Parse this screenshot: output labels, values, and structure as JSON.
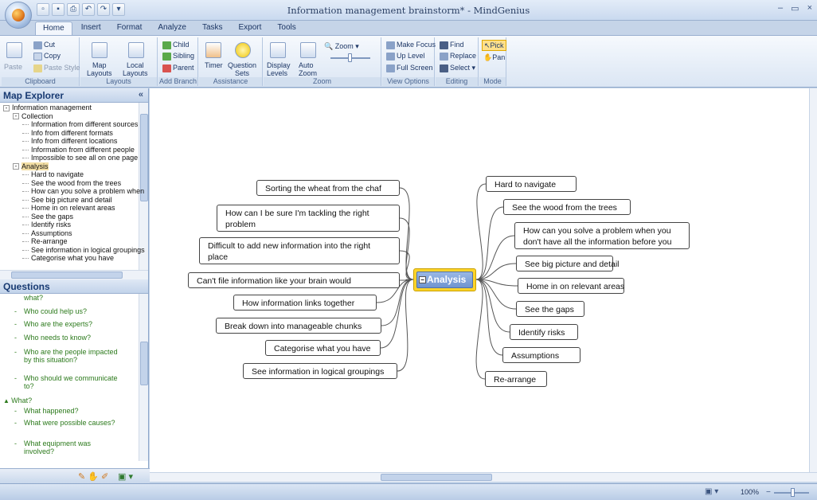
{
  "window": {
    "title": "Information management brainstorm* - MindGenius"
  },
  "tabs": [
    "Home",
    "Insert",
    "Format",
    "Analyze",
    "Tasks",
    "Export",
    "Tools"
  ],
  "ribbon": {
    "clipboard": {
      "label": "Clipboard",
      "paste": "Paste",
      "cut": "Cut",
      "copy": "Copy",
      "paste_style": "Paste Style"
    },
    "layouts": {
      "label": "Layouts",
      "map": "Map\nLayouts",
      "local": "Local\nLayouts"
    },
    "add_branch": {
      "label": "Add Branch",
      "child": "Child",
      "sibling": "Sibling",
      "parent": "Parent"
    },
    "assistance": {
      "label": "Assistance",
      "timer": "Timer",
      "question_sets": "Question\nSets"
    },
    "zoom": {
      "label": "Zoom",
      "display_levels": "Display\nLevels",
      "auto_zoom": "Auto\nZoom",
      "zoom": "Zoom"
    },
    "view_options": {
      "label": "View Options",
      "make_focus": "Make Focus",
      "up_level": "Up Level",
      "full_screen": "Full Screen"
    },
    "editing": {
      "label": "Editing",
      "find": "Find",
      "replace": "Replace",
      "select": "Select"
    },
    "mode": {
      "label": "Mode",
      "pick": "Pick",
      "pan": "Pan"
    }
  },
  "map_explorer": {
    "title": "Map Explorer",
    "items": [
      {
        "text": "Information management",
        "indent": 0,
        "expander": "-"
      },
      {
        "text": "Collection",
        "indent": 1,
        "expander": "-"
      },
      {
        "text": "Information from different sources",
        "indent": 2
      },
      {
        "text": "Info from different formats",
        "indent": 2
      },
      {
        "text": "Info from different locations",
        "indent": 2
      },
      {
        "text": "Information from different people",
        "indent": 2
      },
      {
        "text": "Impossible to see all on one page",
        "indent": 2
      },
      {
        "text": "Analysis",
        "indent": 1,
        "expander": "-",
        "selected": true
      },
      {
        "text": "Hard to navigate",
        "indent": 2
      },
      {
        "text": "See the wood from the trees",
        "indent": 2
      },
      {
        "text": "How can you solve a problem when",
        "indent": 2
      },
      {
        "text": "See big picture and detail",
        "indent": 2
      },
      {
        "text": "Home in on relevant areas",
        "indent": 2
      },
      {
        "text": "See the gaps",
        "indent": 2
      },
      {
        "text": "Identify risks",
        "indent": 2
      },
      {
        "text": "Assumptions",
        "indent": 2
      },
      {
        "text": "Re-arrange",
        "indent": 2
      },
      {
        "text": "See information in logical groupings",
        "indent": 2
      },
      {
        "text": "Categorise what you have",
        "indent": 2
      }
    ]
  },
  "questions": {
    "title": "Questions",
    "items": [
      {
        "text": "what?",
        "kind": "cut"
      },
      {
        "text": "Who could help us?"
      },
      {
        "text": "Who are the experts?"
      },
      {
        "text": "Who needs to know?"
      },
      {
        "text": "Who are the people impacted by this situation?"
      },
      {
        "text": "Who should we communicate to?"
      },
      {
        "text": "What?",
        "kind": "header"
      },
      {
        "text": "What happened?"
      },
      {
        "text": "What were possible causes?"
      },
      {
        "text": "What equipment was involved?"
      }
    ]
  },
  "map": {
    "central": "Analysis",
    "left": [
      "Sorting the wheat from the chaf",
      "How can I be sure I'm tackling the right problem",
      "Difficult to add new information into the right place",
      "Can't file information like your brain would",
      "How information links together",
      "Break down into manageable chunks",
      "Categorise what you have",
      "See information in logical groupings"
    ],
    "right": [
      "Hard to navigate",
      "See the wood from the trees",
      "How can you solve a problem when you don't have all the information before you",
      "See big picture and detail",
      "Home in on relevant areas",
      "See the gaps",
      "Identify risks",
      "Assumptions",
      "Re-arrange"
    ]
  },
  "status": {
    "zoom": "100%"
  }
}
